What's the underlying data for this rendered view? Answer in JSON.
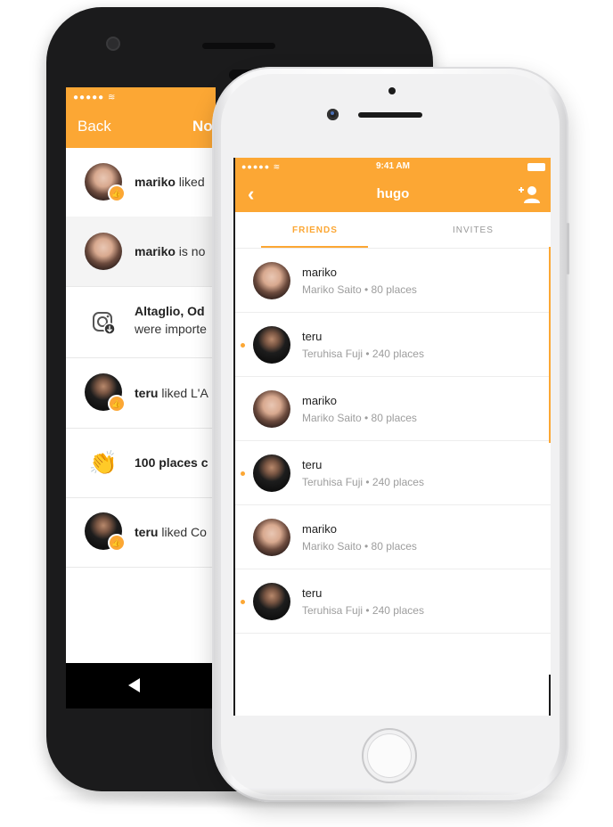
{
  "colors": {
    "accent": "#fca734",
    "dark_phone": "#1b1b1c",
    "white_phone": "#f1f1f2"
  },
  "back_phone": {
    "status": "●●●●● ≋",
    "back_label": "Back",
    "title_partial": "No",
    "notifications": [
      {
        "avatar": "mariko",
        "bold": "mariko",
        "text": " liked",
        "badge": true
      },
      {
        "avatar": "mariko",
        "bold": "mariko",
        "text": " is no",
        "badge": false
      },
      {
        "avatar": "instagram-icon",
        "bold": "Altaglio, Od",
        "text": "were importe",
        "badge": false
      },
      {
        "avatar": "teru",
        "bold": "teru",
        "text": " liked L'A",
        "badge": true
      },
      {
        "avatar": "clap-icon",
        "bold": "100 places c",
        "text": "",
        "badge": false
      },
      {
        "avatar": "teru",
        "bold": "teru",
        "text": " liked Co",
        "badge": true
      }
    ],
    "nav_icon": "back-triangle-icon"
  },
  "front_phone": {
    "status": {
      "signal": "●●●●● ≋",
      "time": "9:41 AM",
      "battery": "battery-icon"
    },
    "header": {
      "back_icon": "chevron-left-icon",
      "title": "hugo",
      "add_icon": "add-friend-icon"
    },
    "tabs": {
      "friends": "FRIENDS",
      "invites": "INVITES",
      "active": "friends"
    },
    "friends": [
      {
        "name": "mariko",
        "subtitle": "Mariko Saito • 80 places",
        "avatar": "mariko",
        "unread": false
      },
      {
        "name": "teru",
        "subtitle": "Teruhisa Fuji • 240 places",
        "avatar": "teru",
        "unread": true
      },
      {
        "name": "mariko",
        "subtitle": "Mariko Saito • 80 places",
        "avatar": "mariko",
        "unread": false
      },
      {
        "name": "teru",
        "subtitle": "Teruhisa Fuji • 240 places",
        "avatar": "teru",
        "unread": true
      },
      {
        "name": "mariko",
        "subtitle": "Mariko Saito • 80 places",
        "avatar": "mariko",
        "unread": false
      },
      {
        "name": "teru",
        "subtitle": "Teruhisa Fuji • 240 places",
        "avatar": "teru",
        "unread": true
      }
    ]
  }
}
